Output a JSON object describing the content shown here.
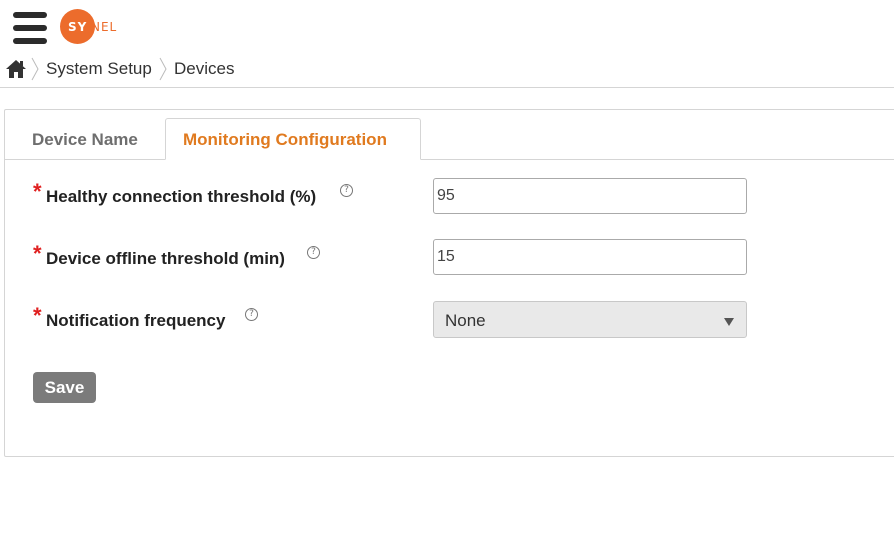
{
  "app": {
    "logo_text_left": "SY",
    "logo_text_right": "NEL",
    "brand_color": "#ec6c2c"
  },
  "breadcrumb": {
    "home_icon": "home-icon",
    "items": [
      "System Setup",
      "Devices"
    ]
  },
  "tabs": [
    {
      "label": "Device Name",
      "active": false
    },
    {
      "label": "Monitoring Configuration",
      "active": true
    }
  ],
  "form": {
    "fields": [
      {
        "label": "Healthy connection threshold (%)",
        "required": true,
        "value": "95",
        "help_icon": "question-circle-icon"
      },
      {
        "label": "Device offline threshold (min)",
        "required": true,
        "value": "15",
        "help_icon": "question-circle-icon"
      },
      {
        "label": "Notification frequency",
        "required": true,
        "value": "None",
        "type": "select",
        "help_icon": "question-circle-icon"
      }
    ],
    "required_marker": "*",
    "help_glyph": "?",
    "save_label": "Save"
  },
  "colors": {
    "active_tab": "#e07a1f",
    "required": "#e02020",
    "save_button": "#7b7b7b"
  }
}
